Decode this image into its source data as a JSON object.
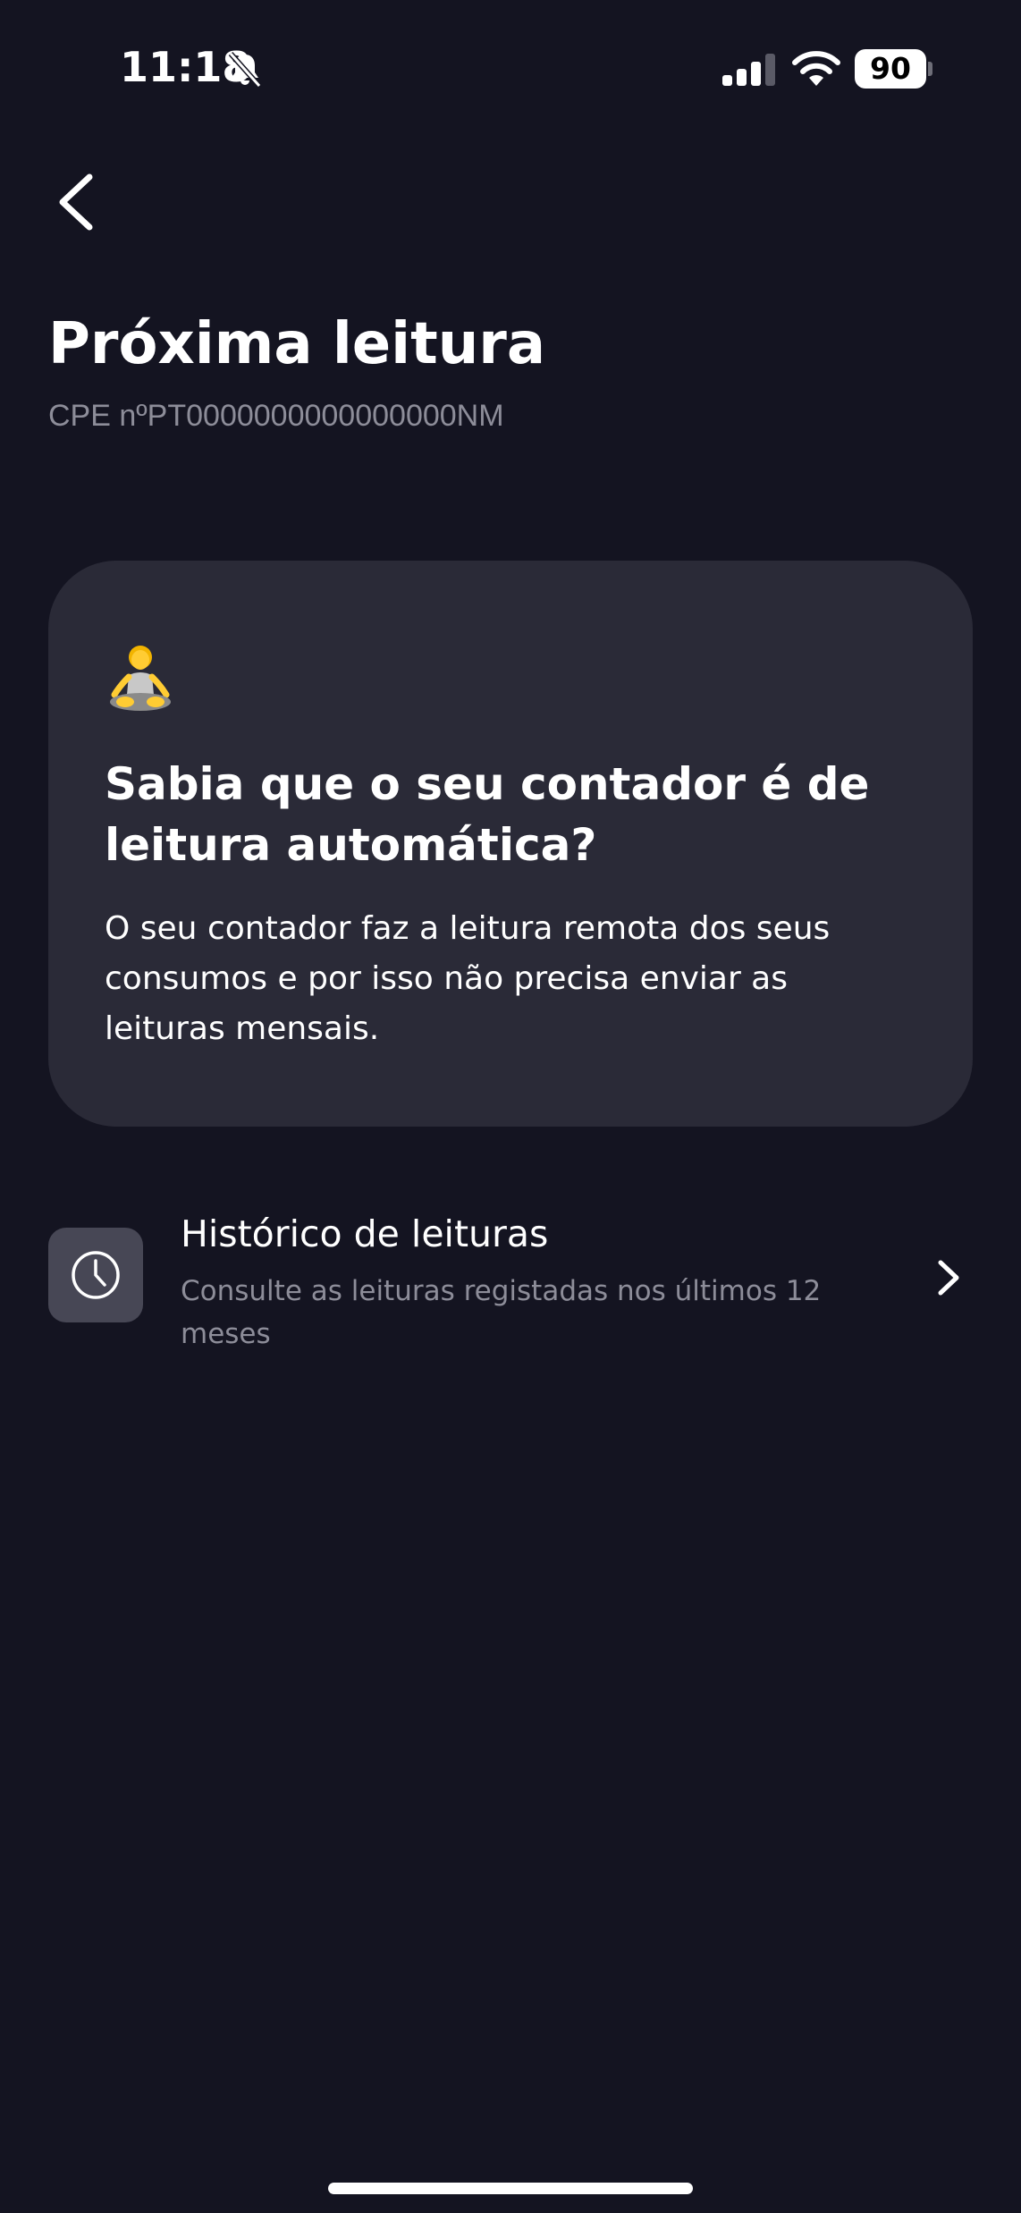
{
  "status_bar": {
    "time": "11:18",
    "battery_level": "90",
    "icons": [
      "bell-slash-icon",
      "signal-icon",
      "wifi-icon",
      "battery-icon"
    ]
  },
  "header": {
    "back_icon": "chevron-left-icon",
    "title": "Próxima leitura",
    "subtitle": "CPE nºPT0000000000000000NM"
  },
  "info_card": {
    "icon": "meditation-emoji",
    "title": "Sabia que o seu contador é de leitura automática?",
    "body": "O seu contador faz a leitura remota dos seus consumos e por isso não precisa enviar as leituras mensais."
  },
  "history": {
    "icon": "clock-icon",
    "title": "Histórico de leituras",
    "description": "Consulte as leituras registadas nos últimos 12 meses",
    "chevron": "chevron-right-icon"
  },
  "colors": {
    "background": "#141421",
    "card": "#2a2a37",
    "icon_box": "#474755",
    "muted_text": "#8d8d99",
    "text": "#ffffff"
  }
}
